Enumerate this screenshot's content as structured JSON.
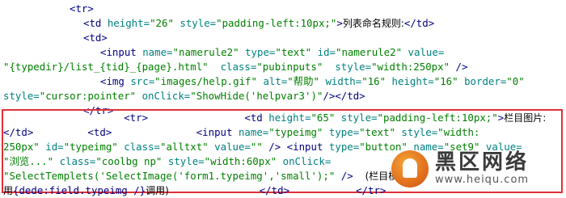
{
  "lines_top": [
    {
      "indent": "ind1",
      "parts": [
        [
          "tag",
          "<tr>"
        ]
      ]
    },
    {
      "indent": "ind2",
      "parts": [
        [
          "tag",
          "<td "
        ],
        [
          "attr",
          "height="
        ],
        [
          "val",
          "\"26\""
        ],
        [
          "tag",
          " "
        ],
        [
          "attr",
          "style="
        ],
        [
          "val",
          "\"padding-left:10px;\""
        ],
        [
          "tag",
          ">"
        ],
        [
          "cn",
          "列表命名规则:"
        ],
        [
          "tag",
          "</td>"
        ]
      ]
    },
    {
      "indent": "ind2",
      "parts": [
        [
          "tag",
          "<td>"
        ]
      ]
    },
    {
      "indent": "ind3",
      "parts": [
        [
          "tag",
          "<input "
        ],
        [
          "attr",
          "name="
        ],
        [
          "val",
          "\"namerule2\""
        ],
        [
          "tag",
          " "
        ],
        [
          "attr",
          "type="
        ],
        [
          "val",
          "\"text\""
        ],
        [
          "tag",
          " "
        ],
        [
          "attr",
          "id="
        ],
        [
          "val",
          "\"namerule2\""
        ],
        [
          "tag",
          " "
        ],
        [
          "attr",
          "value="
        ]
      ]
    },
    {
      "indent": "",
      "parts": [
        [
          "val",
          "\"{typedir}/list_{tid}_{page}.html\""
        ],
        [
          "tag",
          "  "
        ],
        [
          "attr",
          "class="
        ],
        [
          "val",
          "\"pubinputs\""
        ],
        [
          "tag",
          "  "
        ],
        [
          "attr",
          "style="
        ],
        [
          "val",
          "\"width:250px\""
        ],
        [
          "tag",
          " />"
        ]
      ]
    },
    {
      "indent": "ind3",
      "parts": [
        [
          "tag",
          "<img "
        ],
        [
          "attr",
          "src="
        ],
        [
          "val",
          "\"images/help.gif\""
        ],
        [
          "tag",
          " "
        ],
        [
          "attr",
          "alt="
        ],
        [
          "val",
          "\"帮助\""
        ],
        [
          "tag",
          " "
        ],
        [
          "attr",
          "width="
        ],
        [
          "val",
          "\"16\""
        ],
        [
          "tag",
          " "
        ],
        [
          "attr",
          "height="
        ],
        [
          "val",
          "\"16\""
        ],
        [
          "tag",
          " "
        ],
        [
          "attr",
          "border="
        ],
        [
          "val",
          "\"0\""
        ]
      ]
    },
    {
      "indent": "",
      "parts": [
        [
          "attr",
          "style="
        ],
        [
          "val",
          "\"cursor:pointer\""
        ],
        [
          "tag",
          " "
        ],
        [
          "attr",
          "onClick="
        ],
        [
          "val",
          "\"ShowHide('helpvar3')\""
        ],
        [
          "tag",
          "/></td>"
        ]
      ]
    },
    {
      "indent": "ind2",
      "parts": [
        [
          "tag",
          "</tr>"
        ]
      ]
    }
  ],
  "lines_highlight": [
    {
      "parts": [
        [
          "tag",
          "                    <tr>                <td "
        ],
        [
          "attr",
          "height="
        ],
        [
          "val",
          "\"65\""
        ],
        [
          "tag",
          " "
        ],
        [
          "attr",
          "style="
        ],
        [
          "val",
          "\"padding-left:10px;\""
        ],
        [
          "tag",
          ">"
        ],
        [
          "cn",
          "栏目图片:"
        ]
      ]
    },
    {
      "parts": [
        [
          "tag",
          "</td>         <td>              <input "
        ],
        [
          "attr",
          "name="
        ],
        [
          "val",
          "\"typeimg\""
        ],
        [
          "tag",
          " "
        ],
        [
          "attr",
          "type="
        ],
        [
          "val",
          "\"text\""
        ],
        [
          "tag",
          " "
        ],
        [
          "attr",
          "style="
        ],
        [
          "val",
          "\"width:"
        ]
      ]
    },
    {
      "parts": [
        [
          "val",
          "250px\""
        ],
        [
          "tag",
          " "
        ],
        [
          "attr",
          "id="
        ],
        [
          "val",
          "\"typeimg\""
        ],
        [
          "tag",
          " "
        ],
        [
          "attr",
          "class="
        ],
        [
          "val",
          "\"alltxt\""
        ],
        [
          "tag",
          " "
        ],
        [
          "attr",
          "value="
        ],
        [
          "val",
          "\"\""
        ],
        [
          "tag",
          " /> <input "
        ],
        [
          "attr",
          "type="
        ],
        [
          "val",
          "\"button\""
        ],
        [
          "tag",
          " "
        ],
        [
          "attr",
          "name="
        ],
        [
          "val",
          "\"set9\""
        ],
        [
          "tag",
          " "
        ],
        [
          "attr",
          "value="
        ]
      ]
    },
    {
      "parts": [
        [
          "val",
          "\"浏览...\""
        ],
        [
          "tag",
          " "
        ],
        [
          "attr",
          "class="
        ],
        [
          "val",
          "\"coolbg np\""
        ],
        [
          "tag",
          " "
        ],
        [
          "attr",
          "style="
        ],
        [
          "val",
          "\"width:60px\""
        ],
        [
          "tag",
          " "
        ],
        [
          "attr",
          "onClick="
        ]
      ]
    },
    {
      "parts": [
        [
          "val",
          "\"SelectTemplets('SelectImage('form1.typeimg','small');\""
        ],
        [
          "tag",
          " />  "
        ],
        [
          "cn",
          "(栏目模板里"
        ]
      ]
    },
    {
      "parts": [
        [
          "cn",
          "用"
        ],
        [
          "tag",
          "{dede:field.typeimg /}"
        ],
        [
          "cn",
          "调用)"
        ],
        [
          "tag",
          "               </td>           </tr>"
        ]
      ]
    }
  ],
  "watermark": {
    "cn": "黑区网络",
    "en": "www.heiqu.com"
  }
}
